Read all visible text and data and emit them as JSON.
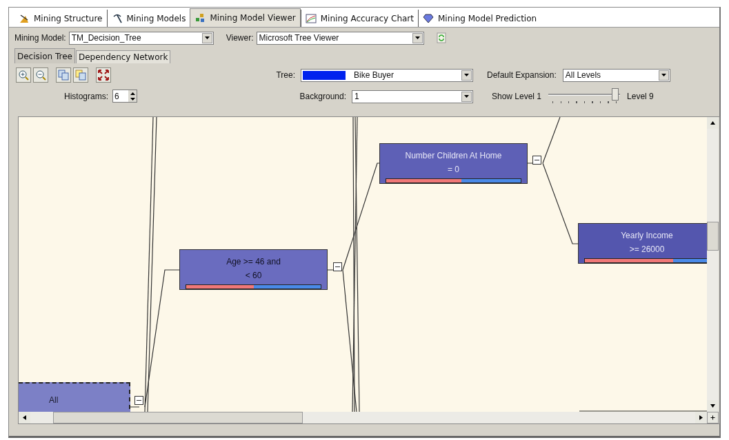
{
  "tabs": [
    {
      "label": "Mining Structure",
      "selected": false
    },
    {
      "label": "Mining Models",
      "selected": false
    },
    {
      "label": "Mining Model Viewer",
      "selected": true
    },
    {
      "label": "Mining Accuracy Chart",
      "selected": false
    },
    {
      "label": "Mining Model Prediction",
      "selected": false
    }
  ],
  "model_bar": {
    "model_label": "Mining Model:",
    "model_value": "TM_Decision_Tree",
    "viewer_label": "Viewer:",
    "viewer_value": "Microsoft Tree Viewer"
  },
  "viewer_tabs": [
    {
      "label": "Decision Tree",
      "selected": true
    },
    {
      "label": "Dependency Network",
      "selected": false
    }
  ],
  "options": {
    "tree_label": "Tree:",
    "tree_value": "Bike Buyer",
    "expansion_label": "Default Expansion:",
    "expansion_value": "All Levels",
    "histograms_label": "Histograms:",
    "histograms_value": "6",
    "background_label": "Background:",
    "background_value": "1",
    "show_level_label": "Show Level 1",
    "level_max_label": "Level 9",
    "level": 1
  },
  "nodes": [
    {
      "lines": [
        "All"
      ],
      "selected": true
    },
    {
      "lines": [
        "Age >= 46 and",
        "< 60"
      ],
      "selected": false,
      "level": 0.5
    },
    {
      "lines": [
        "Number Children At Home",
        "= 0"
      ],
      "selected": false,
      "level": 0.56
    },
    {
      "lines": [
        "Yearly Income",
        ">= 26000"
      ],
      "selected": false,
      "level": 0.71
    }
  ]
}
